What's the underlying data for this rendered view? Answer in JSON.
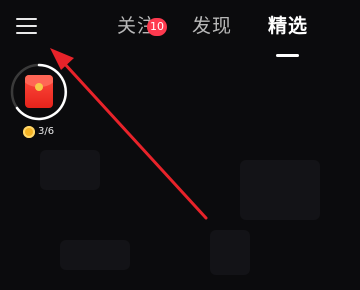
{
  "header": {
    "menu_icon": "hamburger-menu-icon",
    "tabs": [
      {
        "label": "关注",
        "badge": "10"
      },
      {
        "label": "发现"
      },
      {
        "label": "精选",
        "active": true
      }
    ]
  },
  "reward": {
    "icon": "red-envelope-icon",
    "coin_icon": "gold-coin-icon",
    "progress_text": "3/6"
  },
  "annotation": {
    "type": "arrow",
    "color": "#e8232a",
    "points_to": "hamburger-menu-icon"
  },
  "colors": {
    "background": "#0b0b0d",
    "badge": "#fe3a4f",
    "active_tab": "#ffffff",
    "inactive_tab": "#b8b8b8"
  }
}
